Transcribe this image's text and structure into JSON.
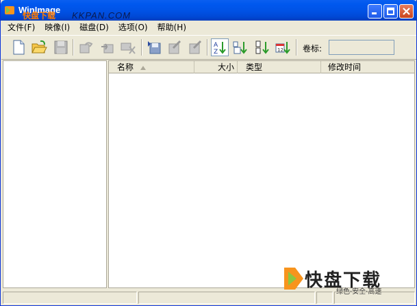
{
  "window": {
    "title": "WinImage",
    "watermark_url": "KKPAN.COM",
    "watermark_cn": "快盘下载"
  },
  "menu": [
    {
      "label": "文件(F)"
    },
    {
      "label": "映像(I)"
    },
    {
      "label": "磁盘(D)"
    },
    {
      "label": "选项(O)"
    },
    {
      "label": "帮助(H)"
    }
  ],
  "toolbar": {
    "volume_label": "卷标:",
    "volume_value": ""
  },
  "list": {
    "columns": [
      {
        "label": "名称"
      },
      {
        "label": "大小"
      },
      {
        "label": "类型"
      },
      {
        "label": "修改时间"
      }
    ],
    "rows": []
  },
  "logo": {
    "name": "快盘下载",
    "tagline": "绿色·安全·高速"
  },
  "colors": {
    "titlebar": "#0053E6",
    "logo_orange": "#F7941D",
    "logo_green": "#8DC63F"
  }
}
